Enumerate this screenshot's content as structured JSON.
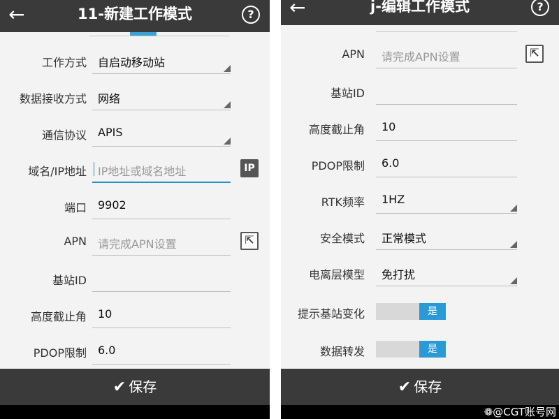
{
  "left": {
    "header": {
      "title": "11-新建工作模式",
      "back_icon": "back-arrow-icon",
      "help_label": "?"
    },
    "rows": [
      {
        "label": "工作方式",
        "value": "自启动移动站",
        "type": "select"
      },
      {
        "label": "数据接收方式",
        "value": "网络",
        "type": "select"
      },
      {
        "label": "通信协议",
        "value": "APIS",
        "type": "select"
      },
      {
        "label": "域名/IP地址",
        "placeholder": "IP地址或域名地址",
        "type": "input-active",
        "button": "IP"
      },
      {
        "label": "端口",
        "value": "9902",
        "type": "input"
      },
      {
        "label": "APN",
        "placeholder": "请完成APN设置",
        "type": "input",
        "button": "⇱"
      },
      {
        "label": "基站ID",
        "value": "",
        "type": "input"
      },
      {
        "label": "高度截止角",
        "value": "10",
        "type": "input"
      },
      {
        "label": "PDOP限制",
        "value": "6.0",
        "type": "input"
      }
    ],
    "footer": {
      "check": "✔",
      "save_label": "保存"
    }
  },
  "right": {
    "header": {
      "title": "j-编辑工作模式",
      "back_icon": "back-arrow-icon",
      "help_label": "?"
    },
    "rows": [
      {
        "label": "APN",
        "placeholder": "请完成APN设置",
        "type": "input",
        "button": "⇱"
      },
      {
        "label": "基站ID",
        "value": "",
        "type": "input"
      },
      {
        "label": "高度截止角",
        "value": "10",
        "type": "input"
      },
      {
        "label": "PDOP限制",
        "value": "6.0",
        "type": "input"
      },
      {
        "label": "RTK频率",
        "value": "1HZ",
        "type": "select"
      },
      {
        "label": "安全模式",
        "value": "正常模式",
        "type": "select"
      },
      {
        "label": "电离层模型",
        "value": "免打扰",
        "type": "select"
      },
      {
        "label": "提示基站变化",
        "toggle": "是",
        "type": "toggle"
      },
      {
        "label": "数据转发",
        "toggle": "是",
        "type": "toggle"
      }
    ],
    "footer": {
      "check": "✔",
      "save_label": "保存"
    },
    "watermark": "❁@CGT账号网"
  },
  "colors": {
    "header_bg": "#3a3a3a",
    "accent": "#2a9ad6",
    "body_bg": "#f3f3f3"
  }
}
